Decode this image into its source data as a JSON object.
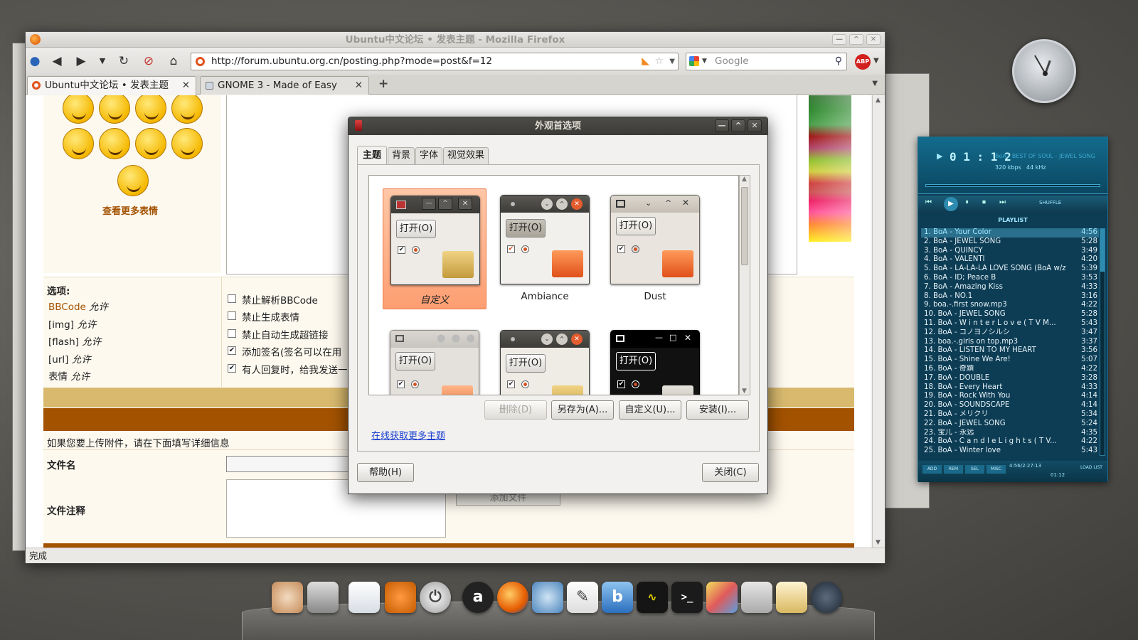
{
  "firefox": {
    "title": "Ubuntu中文论坛 • 发表主题 - Mozilla Firefox",
    "url": "http://forum.ubuntu.org.cn/posting.php?mode=post&f=12",
    "search_placeholder": "Google",
    "tabs": [
      {
        "label": "Ubuntu中文论坛 • 发表主题"
      },
      {
        "label": "GNOME 3 - Made of Easy"
      }
    ],
    "new_tab_symbol": "+",
    "status": "完成"
  },
  "forum": {
    "more_smilies": "查看更多表情",
    "options_title": "选项:",
    "options_left": [
      {
        "label": "BBCode",
        "value": "允许"
      },
      {
        "label": "[img]",
        "value": "允许"
      },
      {
        "label": "[flash]",
        "value": "允许"
      },
      {
        "label": "[url]",
        "value": "允许"
      },
      {
        "label": "表情",
        "value": "允许"
      }
    ],
    "checkboxes": [
      {
        "label": "禁止解析BBCode",
        "checked": false
      },
      {
        "label": "禁止生成表情",
        "checked": false
      },
      {
        "label": "禁止自动生成超链接",
        "checked": false
      },
      {
        "label": "添加签名(签名可以在用",
        "checked": true
      },
      {
        "label": "有人回复时，给我发送一",
        "checked": true
      }
    ],
    "attach_hint": "如果您要上传附件，请在下面填写详细信息",
    "filename_label": "文件名",
    "filecomment_label": "文件注释",
    "add_file_button": "添加文件"
  },
  "dialog": {
    "title": "外观首选项",
    "tabs": [
      "主题",
      "背景",
      "字体",
      "视觉效果"
    ],
    "themes": [
      {
        "name": "自定义",
        "button": "打开(O)"
      },
      {
        "name": "Ambiance",
        "button": "打开(O)"
      },
      {
        "name": "Dust",
        "button": "打开(O)"
      },
      {
        "name": "",
        "button": "打开(O)"
      },
      {
        "name": "",
        "button": "打开(O)"
      },
      {
        "name": "",
        "button": "打开(O)"
      }
    ],
    "buttons": {
      "delete": "删除(D)",
      "save_as": "另存为(A)...",
      "customize": "自定义(U)...",
      "install": "安装(I)..."
    },
    "online_link": "在线获取更多主题",
    "help": "帮助(H)",
    "close": "关闭(C)"
  },
  "player": {
    "time": "0 1 : 1 2",
    "marquee": "BoA - BEST OF SOUL - JEWEL SONG",
    "bitrate": "320 kbps",
    "samplerate": "44 kHz",
    "shuffle": "SHUFFLE",
    "playlist_title": "PLAYLIST",
    "playlist": [
      {
        "title": "1. BoA - Your Color",
        "dur": "4:56"
      },
      {
        "title": "2. BoA - JEWEL SONG",
        "dur": "5:28"
      },
      {
        "title": "3. BoA - QUINCY",
        "dur": "3:49"
      },
      {
        "title": "4. BoA - VALENTI",
        "dur": "4:20"
      },
      {
        "title": "5. BoA - LA-LA-LA LOVE SONG (BoA w/z",
        "dur": "5:39"
      },
      {
        "title": "6. BoA - ID; Peace B",
        "dur": "3:53"
      },
      {
        "title": "7. BoA - Amazing Kiss",
        "dur": "4:33"
      },
      {
        "title": "8. BoA - NO.1",
        "dur": "3:16"
      },
      {
        "title": "9. boa.-.first snow.mp3",
        "dur": "4:22"
      },
      {
        "title": "10. BoA - JEWEL SONG",
        "dur": "5:28"
      },
      {
        "title": "11. BoA - W i n t e r   L o v e ( T V   M...",
        "dur": "5:43"
      },
      {
        "title": "12. BoA - コノヨノシルシ",
        "dur": "3:47"
      },
      {
        "title": "13. boa.-.girls on top.mp3",
        "dur": "3:37"
      },
      {
        "title": "14. BoA - LISTEN TO MY HEART",
        "dur": "3:56"
      },
      {
        "title": "15. BoA - Shine We Are!",
        "dur": "5:07"
      },
      {
        "title": "16. BoA - 奇蹟",
        "dur": "4:22"
      },
      {
        "title": "17. BoA - DOUBLE",
        "dur": "3:28"
      },
      {
        "title": "18. BoA - Every Heart",
        "dur": "4:33"
      },
      {
        "title": "19. BoA - Rock With You",
        "dur": "4:14"
      },
      {
        "title": "20. BoA - SOUNDSCAPE",
        "dur": "4:14"
      },
      {
        "title": "21. BoA - メリクリ",
        "dur": "5:34"
      },
      {
        "title": "22. BoA - JEWEL SONG",
        "dur": "5:24"
      },
      {
        "title": "23. 宝儿 - 永远",
        "dur": "4:35"
      },
      {
        "title": "24. BoA - C a n d l e   L i g h t s ( T V...",
        "dur": "4:22"
      },
      {
        "title": "25. BoA - Winter love",
        "dur": "5:43"
      }
    ],
    "bottom_buttons": [
      "ADD",
      "REM",
      "SEL",
      "MISC"
    ],
    "counter": "4:56/2:27:13",
    "counter2": "01:12",
    "list_btn": "LOAD LIST"
  },
  "dock": {
    "terminal_label": ">_",
    "amazon_label": "a"
  },
  "colors": {
    "accent_orange": "#e86a2c",
    "forum_brown": "#a35200",
    "link_blue": "#1b3fd1",
    "player_teal": "#0d3d55"
  }
}
